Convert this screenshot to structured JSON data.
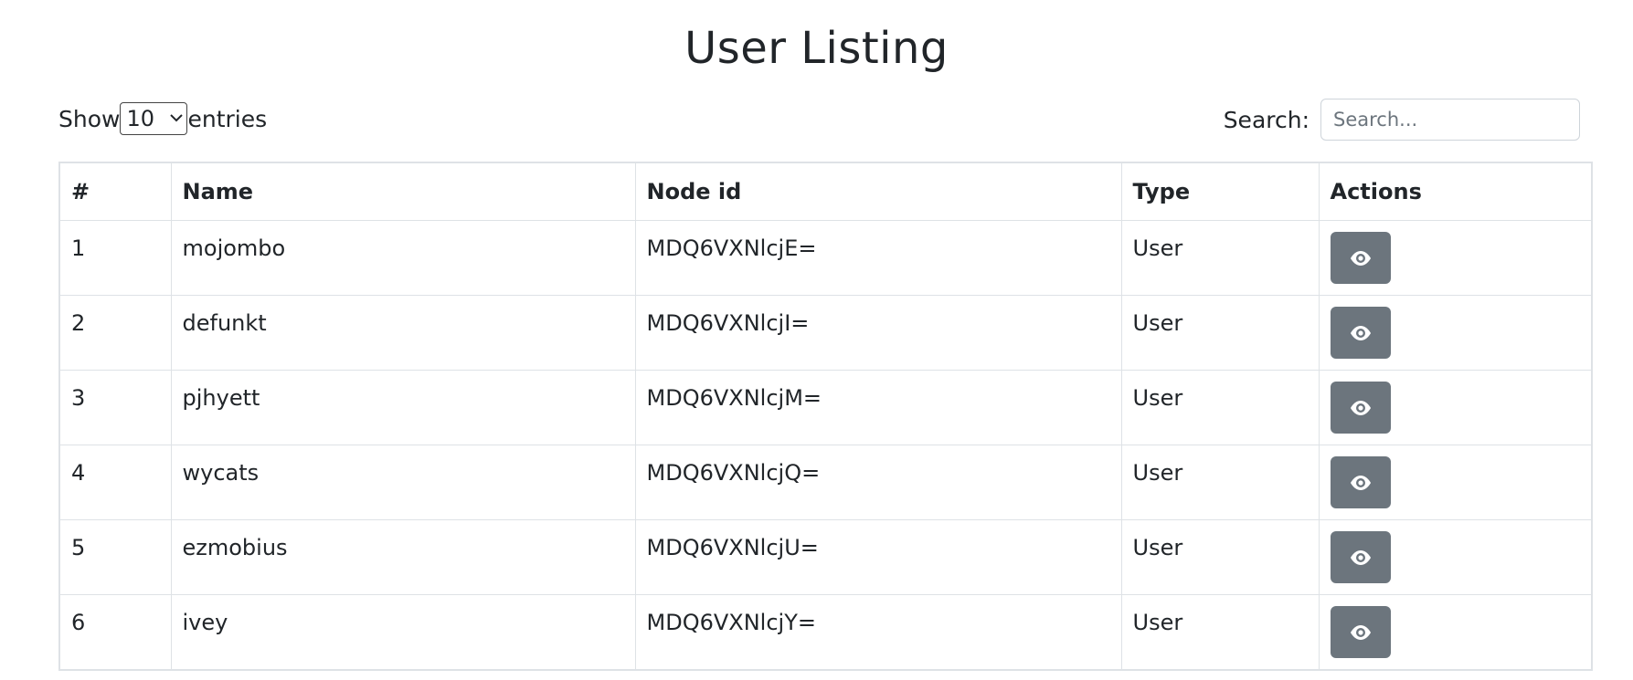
{
  "page": {
    "title": "User Listing"
  },
  "length_menu": {
    "prefix": "Show",
    "selected": "10",
    "suffix": "entries"
  },
  "search": {
    "label": "Search:",
    "placeholder": "Search...",
    "value": ""
  },
  "table": {
    "columns": [
      "#",
      "Name",
      "Node id",
      "Type",
      "Actions"
    ],
    "rows": [
      {
        "num": "1",
        "name": "mojombo",
        "node_id": "MDQ6VXNlcjE=",
        "type": "User"
      },
      {
        "num": "2",
        "name": "defunkt",
        "node_id": "MDQ6VXNlcjI=",
        "type": "User"
      },
      {
        "num": "3",
        "name": "pjhyett",
        "node_id": "MDQ6VXNlcjM=",
        "type": "User"
      },
      {
        "num": "4",
        "name": "wycats",
        "node_id": "MDQ6VXNlcjQ=",
        "type": "User"
      },
      {
        "num": "5",
        "name": "ezmobius",
        "node_id": "MDQ6VXNlcjU=",
        "type": "User"
      },
      {
        "num": "6",
        "name": "ivey",
        "node_id": "MDQ6VXNlcjY=",
        "type": "User"
      }
    ],
    "action_icon": "eye-icon"
  },
  "colors": {
    "action_button": "#6c757d",
    "border": "#dee2e6",
    "text": "#212529"
  }
}
